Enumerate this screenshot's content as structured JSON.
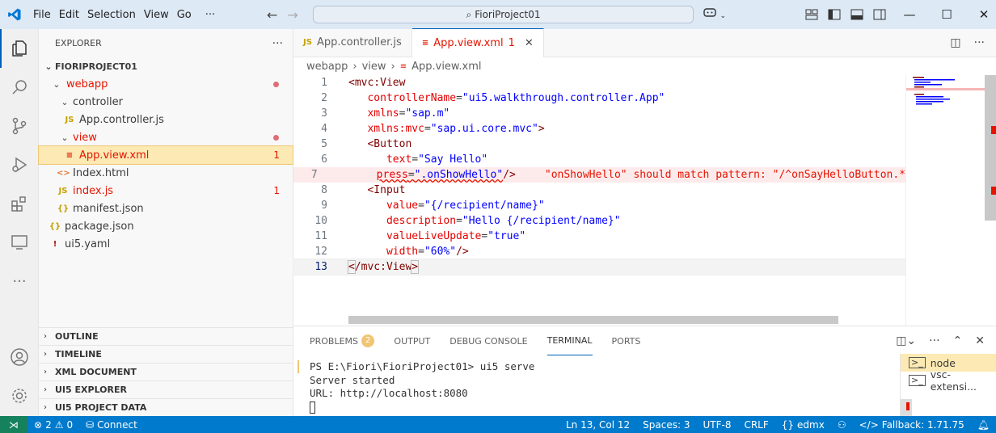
{
  "menu": {
    "file": "File",
    "edit": "Edit",
    "selection": "Selection",
    "view": "View",
    "go": "Go",
    "more": "···"
  },
  "command_center": {
    "text": "FioriProject01"
  },
  "explorer": {
    "title": "EXPLORER",
    "more": "···",
    "root": "FIORIPROJECT01",
    "items": [
      {
        "label": "webapp",
        "badge": ""
      },
      {
        "label": "controller",
        "badge": ""
      },
      {
        "label": "App.controller.js",
        "badge": ""
      },
      {
        "label": "view",
        "badge": ""
      },
      {
        "label": "App.view.xml",
        "badge": "1"
      },
      {
        "label": "Index.html",
        "badge": ""
      },
      {
        "label": "index.js",
        "badge": "1"
      },
      {
        "label": "manifest.json",
        "badge": ""
      },
      {
        "label": "package.json",
        "badge": ""
      },
      {
        "label": "ui5.yaml",
        "badge": ""
      }
    ],
    "sections": [
      "OUTLINE",
      "TIMELINE",
      "XML DOCUMENT",
      "UI5 EXPLORER",
      "UI5 PROJECT DATA"
    ]
  },
  "tabs": [
    {
      "label": "App.controller.js"
    },
    {
      "label": "App.view.xml",
      "badge": "1"
    }
  ],
  "breadcrumb": {
    "a": "webapp",
    "b": "view",
    "c": "App.view.xml"
  },
  "code": {
    "error_message": "\"onShowHello\" should match pattern: \"/^onSayHelloButton.*"
  },
  "panel": {
    "tabs": {
      "problems": "PROBLEMS",
      "problems_count": "2",
      "output": "OUTPUT",
      "debug": "DEBUG CONSOLE",
      "terminal": "TERMINAL",
      "ports": "PORTS"
    },
    "terminal_lines": [
      "PS E:\\Fiori\\FioriProject01> ui5 serve",
      "Server started",
      "URL: http://localhost:8080"
    ],
    "terminal_list": [
      {
        "label": "node"
      },
      {
        "label": "vsc-extensi..."
      }
    ]
  },
  "status": {
    "errors": "2",
    "warnings": "0",
    "connect": "Connect",
    "position": "Ln 13, Col 12",
    "spaces": "Spaces: 3",
    "encoding": "UTF-8",
    "eol": "CRLF",
    "language": "edmx",
    "fallback": "Fallback: 1.71.75"
  }
}
